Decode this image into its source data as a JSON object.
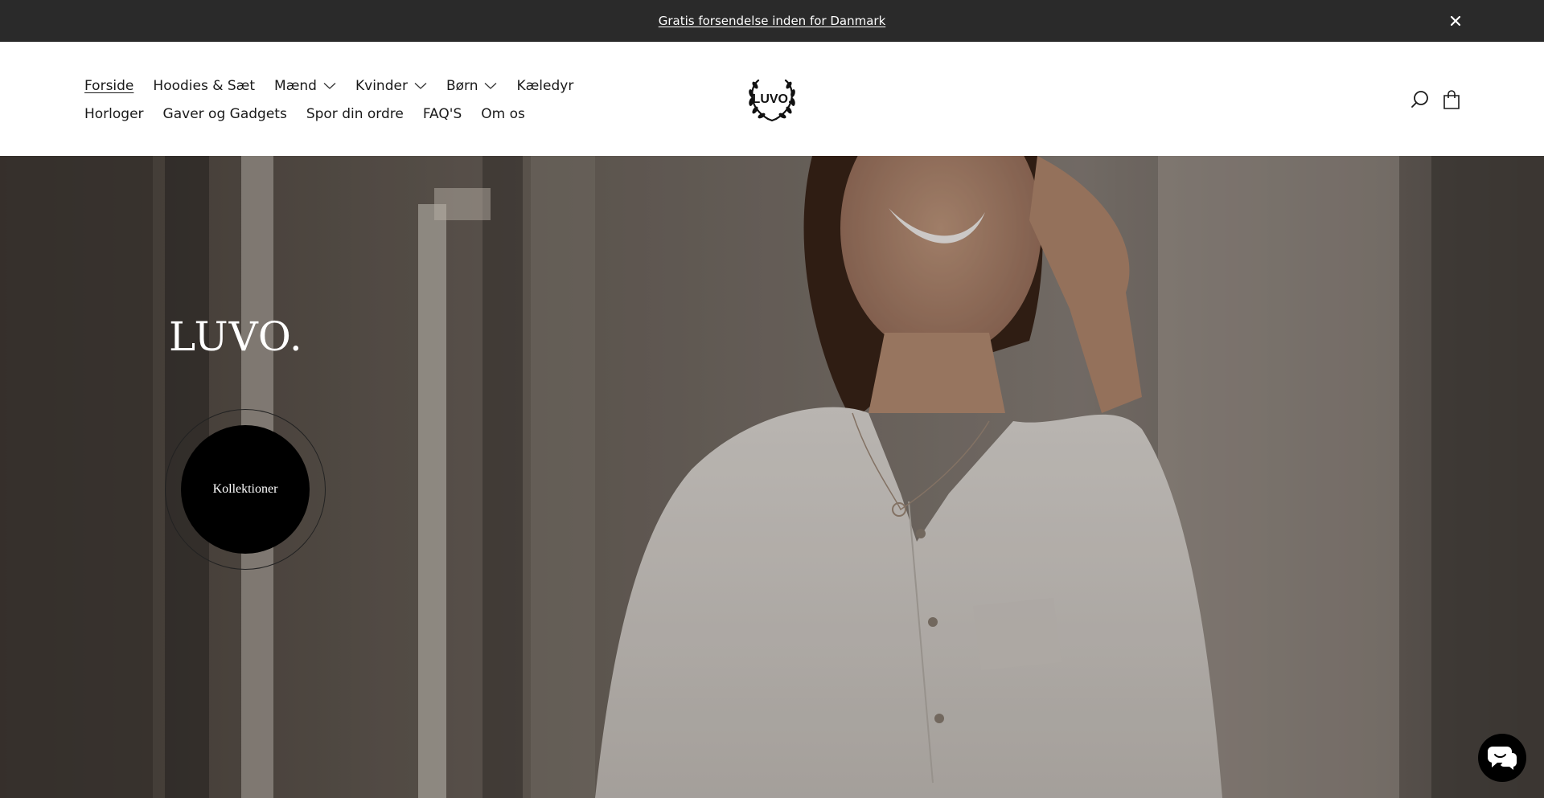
{
  "announcement": {
    "text": "Gratis forsendelse inden for Danmark",
    "close_icon": "close-icon"
  },
  "nav": {
    "row1": [
      {
        "label": "Forside",
        "active": true,
        "dropdown": false
      },
      {
        "label": "Hoodies & Sæt",
        "dropdown": false
      },
      {
        "label": "Mænd",
        "dropdown": true
      },
      {
        "label": "Kvinder",
        "dropdown": true
      },
      {
        "label": "Børn",
        "dropdown": true
      },
      {
        "label": "Kæledyr",
        "dropdown": false
      }
    ],
    "row2": [
      {
        "label": "Horloger"
      },
      {
        "label": "Gaver og Gadgets"
      },
      {
        "label": "Spor din ordre"
      },
      {
        "label": "FAQ'S"
      },
      {
        "label": "Om os"
      }
    ]
  },
  "logo": {
    "text": "LUVO."
  },
  "header_icons": [
    "search-icon",
    "cart-icon"
  ],
  "hero": {
    "title": "LUVO.",
    "cta_label": "Kollektioner"
  },
  "chat": {
    "icon": "chat-icon"
  },
  "colors": {
    "announcement_bg": "#2a2a2a",
    "cta_bg": "#000000",
    "text": "#1a1a1a"
  }
}
